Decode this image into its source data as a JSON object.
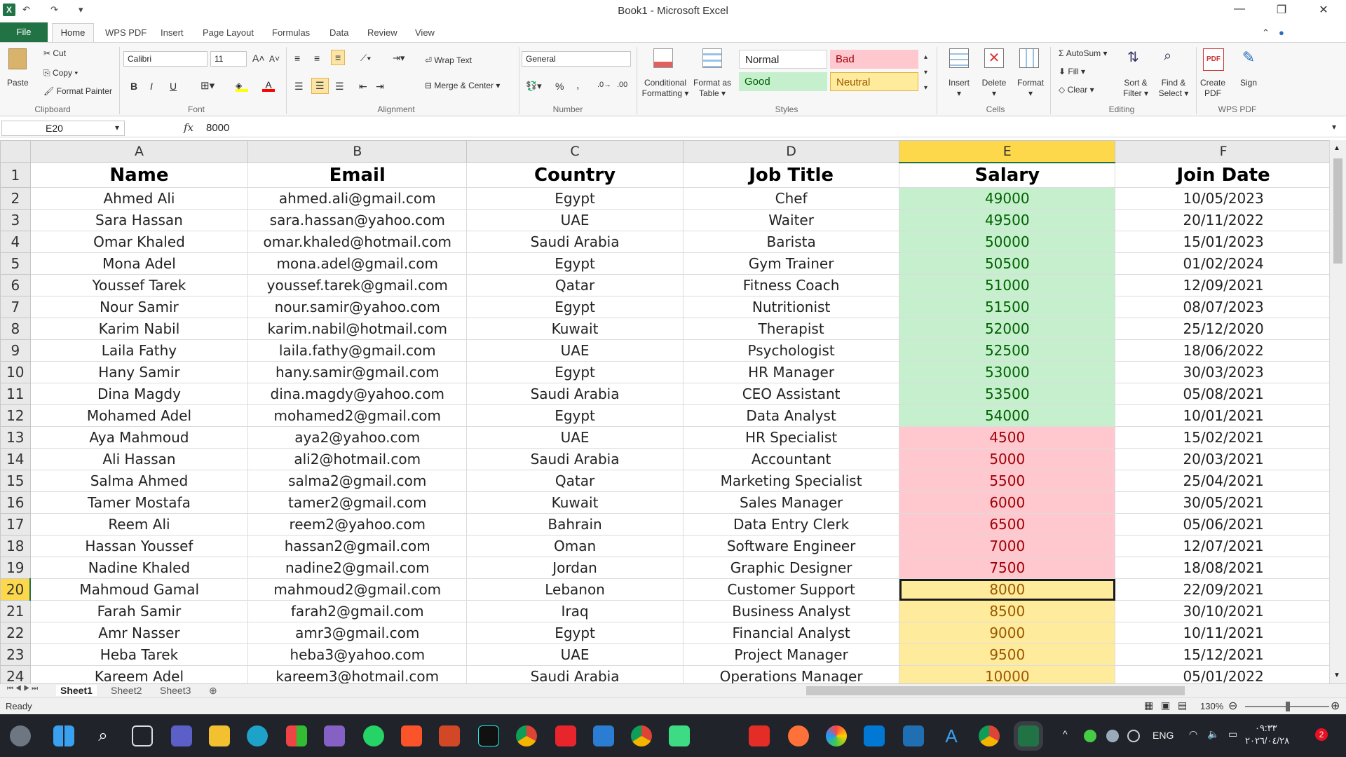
{
  "app": {
    "title": "Book1  -  Microsoft Excel"
  },
  "qat": {
    "undo": "↶",
    "redo": "↷"
  },
  "ribbon_tabs": [
    "File",
    "Home",
    "WPS PDF",
    "Insert",
    "Page Layout",
    "Formulas",
    "Data",
    "Review",
    "View"
  ],
  "clipboard": {
    "paste": "Paste",
    "cut": "Cut",
    "copy": "Copy",
    "format_painter": "Format Painter",
    "label": "Clipboard"
  },
  "font": {
    "name": "Calibri",
    "size": "11",
    "label": "Font",
    "bold": "B",
    "italic": "I",
    "underline": "U"
  },
  "alignment": {
    "wrap_text": "Wrap Text",
    "merge_center": "Merge & Center",
    "label": "Alignment"
  },
  "number": {
    "format": "General",
    "percent": "%",
    "comma": ",",
    "label": "Number"
  },
  "styles": {
    "conditional": "Conditional Formatting",
    "format_table": "Format as Table",
    "normal": "Normal",
    "bad": "Bad",
    "good": "Good",
    "neutral": "Neutral",
    "label": "Styles"
  },
  "cells": {
    "insert": "Insert",
    "delete": "Delete",
    "format": "Format",
    "label": "Cells"
  },
  "editing": {
    "autosum": "AutoSum",
    "fill": "Fill",
    "clear": "Clear",
    "sort_filter": "Sort & Filter",
    "find_select": "Find & Select",
    "label": "Editing"
  },
  "wpspdf": {
    "create_pdf": "Create PDF",
    "sign": "Sign",
    "label": "WPS PDF"
  },
  "formula_bar": {
    "name_box": "E20",
    "fx": "fx",
    "value": "8000"
  },
  "columns": [
    "A",
    "B",
    "C",
    "D",
    "E",
    "F"
  ],
  "table": {
    "headers": [
      "Name",
      "Email",
      "Country",
      "Job Title",
      "Salary",
      "Join Date"
    ],
    "rows": [
      {
        "n": "2",
        "name": "Ahmed Ali",
        "email": "ahmed.ali@gmail.com",
        "country": "Egypt",
        "job": "Chef",
        "salary": "49000",
        "date": "10/05/2023",
        "fmt": "green"
      },
      {
        "n": "3",
        "name": "Sara Hassan",
        "email": "sara.hassan@yahoo.com",
        "country": "UAE",
        "job": "Waiter",
        "salary": "49500",
        "date": "20/11/2022",
        "fmt": "green"
      },
      {
        "n": "4",
        "name": "Omar Khaled",
        "email": "omar.khaled@hotmail.com",
        "country": "Saudi Arabia",
        "job": "Barista",
        "salary": "50000",
        "date": "15/01/2023",
        "fmt": "green"
      },
      {
        "n": "5",
        "name": "Mona Adel",
        "email": "mona.adel@gmail.com",
        "country": "Egypt",
        "job": "Gym Trainer",
        "salary": "50500",
        "date": "01/02/2024",
        "fmt": "green"
      },
      {
        "n": "6",
        "name": "Youssef Tarek",
        "email": "youssef.tarek@gmail.com",
        "country": "Qatar",
        "job": "Fitness Coach",
        "salary": "51000",
        "date": "12/09/2021",
        "fmt": "green"
      },
      {
        "n": "7",
        "name": "Nour Samir",
        "email": "nour.samir@yahoo.com",
        "country": "Egypt",
        "job": "Nutritionist",
        "salary": "51500",
        "date": "08/07/2023",
        "fmt": "green"
      },
      {
        "n": "8",
        "name": "Karim Nabil",
        "email": "karim.nabil@hotmail.com",
        "country": "Kuwait",
        "job": "Therapist",
        "salary": "52000",
        "date": "25/12/2020",
        "fmt": "green"
      },
      {
        "n": "9",
        "name": "Laila Fathy",
        "email": "laila.fathy@gmail.com",
        "country": "UAE",
        "job": "Psychologist",
        "salary": "52500",
        "date": "18/06/2022",
        "fmt": "green"
      },
      {
        "n": "10",
        "name": "Hany Samir",
        "email": "hany.samir@gmail.com",
        "country": "Egypt",
        "job": "HR Manager",
        "salary": "53000",
        "date": "30/03/2023",
        "fmt": "green"
      },
      {
        "n": "11",
        "name": "Dina Magdy",
        "email": "dina.magdy@yahoo.com",
        "country": "Saudi Arabia",
        "job": "CEO Assistant",
        "salary": "53500",
        "date": "05/08/2021",
        "fmt": "green"
      },
      {
        "n": "12",
        "name": "Mohamed Adel",
        "email": "mohamed2@gmail.com",
        "country": "Egypt",
        "job": "Data Analyst",
        "salary": "54000",
        "date": "10/01/2021",
        "fmt": "green"
      },
      {
        "n": "13",
        "name": "Aya Mahmoud",
        "email": "aya2@yahoo.com",
        "country": "UAE",
        "job": "HR Specialist",
        "salary": "4500",
        "date": "15/02/2021",
        "fmt": "red"
      },
      {
        "n": "14",
        "name": "Ali Hassan",
        "email": "ali2@hotmail.com",
        "country": "Saudi Arabia",
        "job": "Accountant",
        "salary": "5000",
        "date": "20/03/2021",
        "fmt": "red"
      },
      {
        "n": "15",
        "name": "Salma Ahmed",
        "email": "salma2@gmail.com",
        "country": "Qatar",
        "job": "Marketing Specialist",
        "salary": "5500",
        "date": "25/04/2021",
        "fmt": "red"
      },
      {
        "n": "16",
        "name": "Tamer Mostafa",
        "email": "tamer2@gmail.com",
        "country": "Kuwait",
        "job": "Sales Manager",
        "salary": "6000",
        "date": "30/05/2021",
        "fmt": "red"
      },
      {
        "n": "17",
        "name": "Reem Ali",
        "email": "reem2@yahoo.com",
        "country": "Bahrain",
        "job": "Data Entry Clerk",
        "salary": "6500",
        "date": "05/06/2021",
        "fmt": "red"
      },
      {
        "n": "18",
        "name": "Hassan Youssef",
        "email": "hassan2@gmail.com",
        "country": "Oman",
        "job": "Software Engineer",
        "salary": "7000",
        "date": "12/07/2021",
        "fmt": "red"
      },
      {
        "n": "19",
        "name": "Nadine Khaled",
        "email": "nadine2@gmail.com",
        "country": "Jordan",
        "job": "Graphic Designer",
        "salary": "7500",
        "date": "18/08/2021",
        "fmt": "red"
      },
      {
        "n": "20",
        "name": "Mahmoud Gamal",
        "email": "mahmoud2@gmail.com",
        "country": "Lebanon",
        "job": "Customer Support",
        "salary": "8000",
        "date": "22/09/2021",
        "fmt": "yellow active"
      },
      {
        "n": "21",
        "name": "Farah Samir",
        "email": "farah2@gmail.com",
        "country": "Iraq",
        "job": "Business Analyst",
        "salary": "8500",
        "date": "30/10/2021",
        "fmt": "yellow"
      },
      {
        "n": "22",
        "name": "Amr Nasser",
        "email": "amr3@gmail.com",
        "country": "Egypt",
        "job": "Financial Analyst",
        "salary": "9000",
        "date": "10/11/2021",
        "fmt": "yellow"
      },
      {
        "n": "23",
        "name": "Heba Tarek",
        "email": "heba3@yahoo.com",
        "country": "UAE",
        "job": "Project Manager",
        "salary": "9500",
        "date": "15/12/2021",
        "fmt": "yellow"
      },
      {
        "n": "24",
        "name": "Kareem Adel",
        "email": "kareem3@hotmail.com",
        "country": "Saudi Arabia",
        "job": "Operations Manager",
        "salary": "10000",
        "date": "05/01/2022",
        "fmt": "yellow"
      }
    ]
  },
  "sheets": [
    "Sheet1",
    "Sheet2",
    "Sheet3"
  ],
  "status": {
    "ready": "Ready",
    "zoom": "130%"
  },
  "tray": {
    "lang": "ENG",
    "time": "٠٩:٣٣",
    "date": "٢٠٢٦/٠٤/٢٨",
    "notif": "2"
  },
  "colors": {
    "excel_green": "#217346",
    "good_fill": "#c6efce",
    "bad_fill": "#ffc7ce",
    "neutral_fill": "#ffeb9c",
    "header_sel": "#fdd84a"
  }
}
